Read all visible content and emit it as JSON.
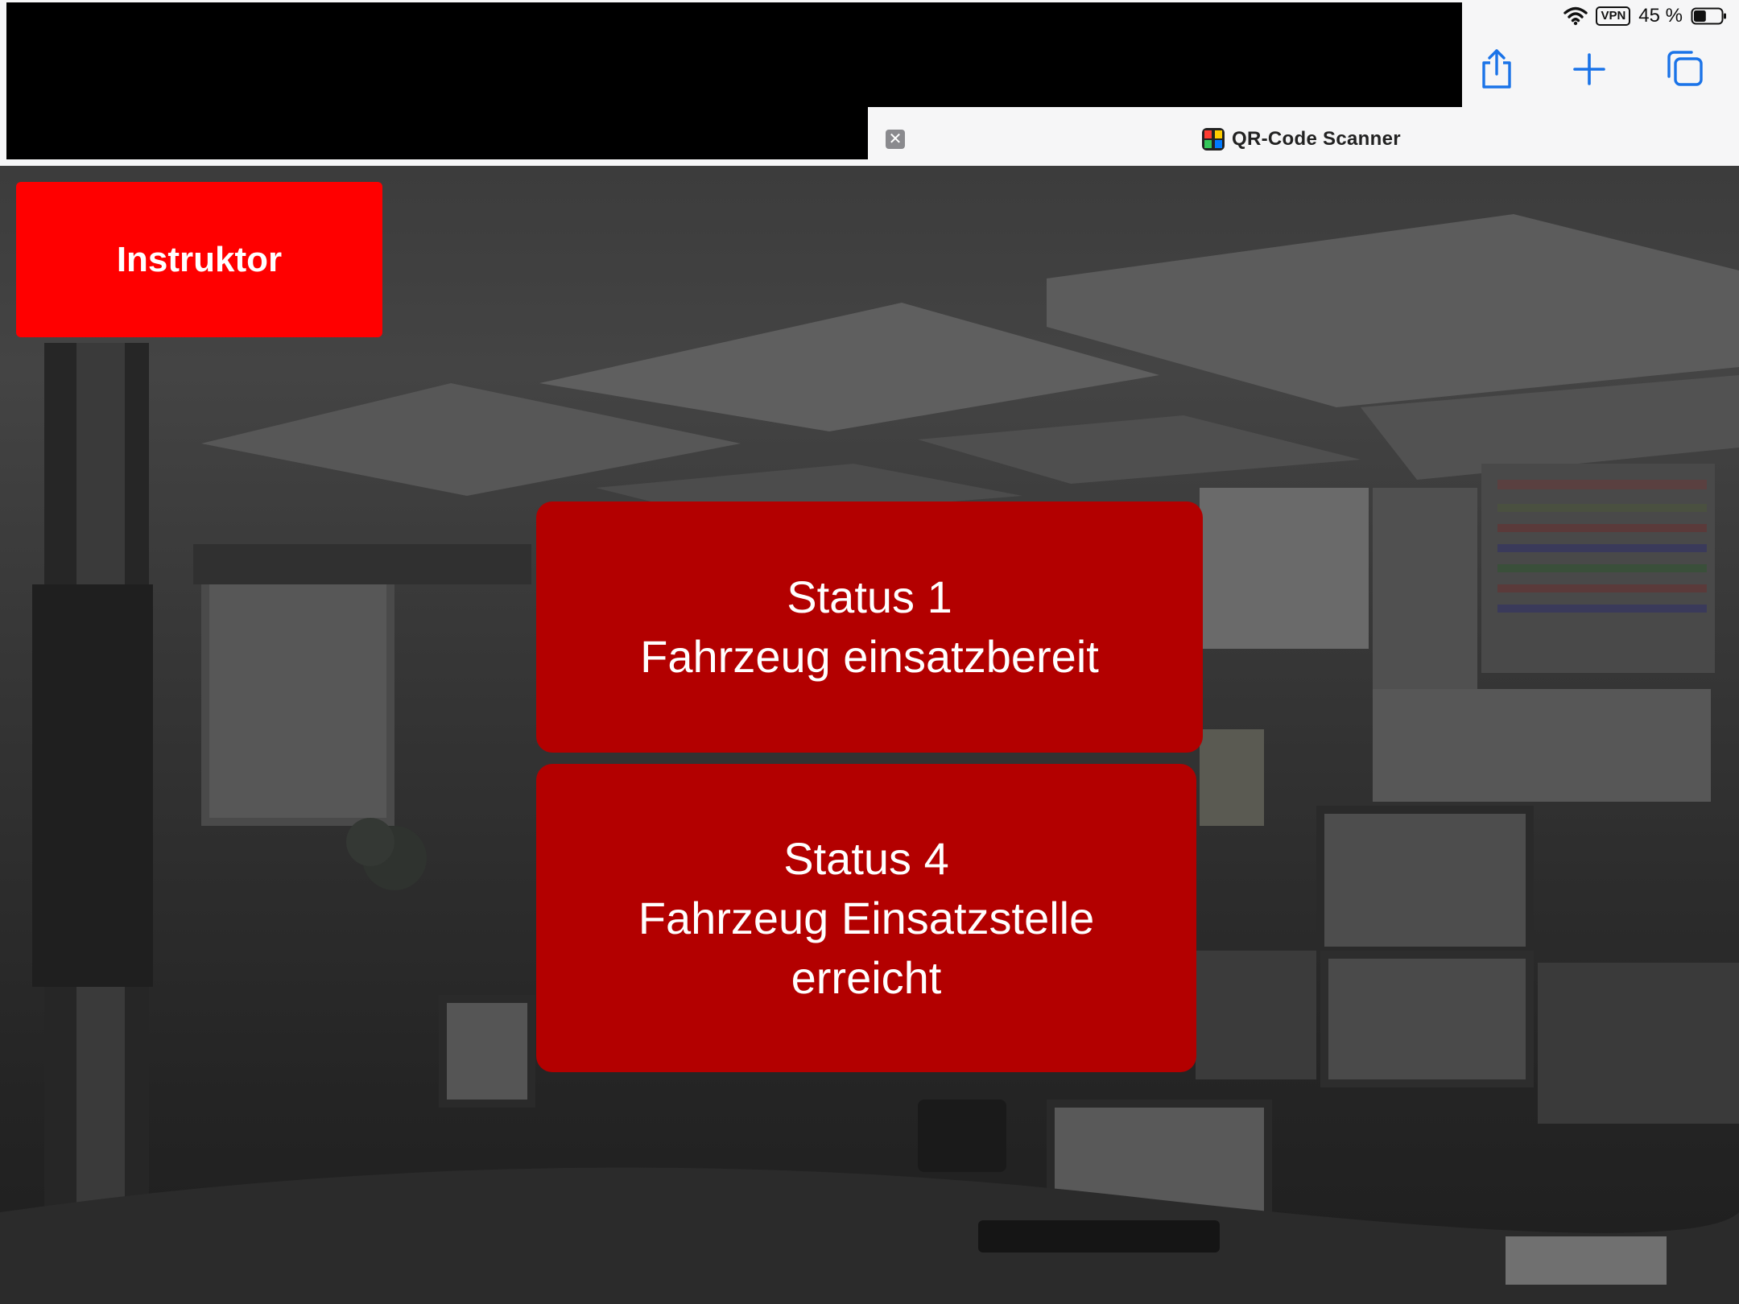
{
  "status_bar": {
    "vpn": "VPN",
    "battery": "45 %",
    "battery_level": 0.45
  },
  "toolbar": {
    "share_icon": "share-icon",
    "new_tab_icon": "plus-icon",
    "tabs_icon": "tabs-icon"
  },
  "tab": {
    "close_glyph": "✕",
    "title": "QR-Code Scanner"
  },
  "main": {
    "instruktor_label": "Instruktor",
    "status1": {
      "line1": "Status 1",
      "line2": "Fahrzeug einsatzbereit"
    },
    "status4": {
      "line1": "Status 4",
      "line2": "Fahrzeug Einsatzstelle",
      "line3": "erreicht"
    }
  },
  "colors": {
    "accent_blue": "#1a73e8",
    "instruktor_red": "#ff0000",
    "status_red": "#b30000"
  }
}
